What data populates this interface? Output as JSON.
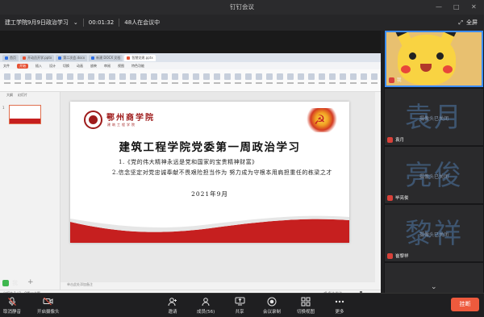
{
  "window": {
    "title": "钉钉会议"
  },
  "info": {
    "meeting_name": "建工学院9月9日政治学习",
    "duration": "00:01:32",
    "count": "48人在会议中",
    "fullscreen": "全屏"
  },
  "wps": {
    "tabs": [
      "首页",
      "开动员开学.pptx",
      "第二次会.docx",
      "新建 DOCX 文档",
      "智慧党建.pptx"
    ],
    "menu": [
      "文件",
      "开始",
      "插入",
      "设计",
      "切换",
      "动画",
      "放映",
      "审阅",
      "视图",
      "特色功能"
    ],
    "thumb_tabs": [
      "大纲",
      "幻灯片"
    ],
    "notes": "单击此处添加备注",
    "status_left": "幻灯片 1 / 1",
    "status_theme": "Office主题",
    "status_right": "唱 备注 批注"
  },
  "slide": {
    "school_cn": "鄂州商学院",
    "school_sub": "建筑工程学院",
    "title": "建筑工程学院党委第一周政治学习",
    "item1": "1.《党的伟大精神永远是党和国家的宝贵精神财富》",
    "item2": "2.信念坚定对党忠诚奉献不畏艰险担当作为 努力成为守根本用肩担重任的栋梁之才",
    "date": "2021年9月"
  },
  "speaker": {
    "label": "我"
  },
  "participants": [
    {
      "name": "我",
      "type": "video"
    },
    {
      "name": "袁月",
      "big": "袁月",
      "status": "摄像头已关闭"
    },
    {
      "name": "毕亮俊",
      "big": "亮俊",
      "status": "摄像头已关闭"
    },
    {
      "name": "崔黎祥",
      "big": "黎祥",
      "status": "摄像头已关闭"
    }
  ],
  "toolbar": {
    "mute": "取消静音",
    "camera": "开启摄像头",
    "invite": "邀请",
    "members": "成员(56)",
    "share": "共享",
    "record": "会议录制",
    "view": "切换视图",
    "more": "更多",
    "leave": "挂断"
  },
  "colors": {
    "leave": "#ee5a3d",
    "mic_on": "#3fb74f",
    "mic_off": "#d8413a",
    "active_border": "#3c8dff"
  }
}
